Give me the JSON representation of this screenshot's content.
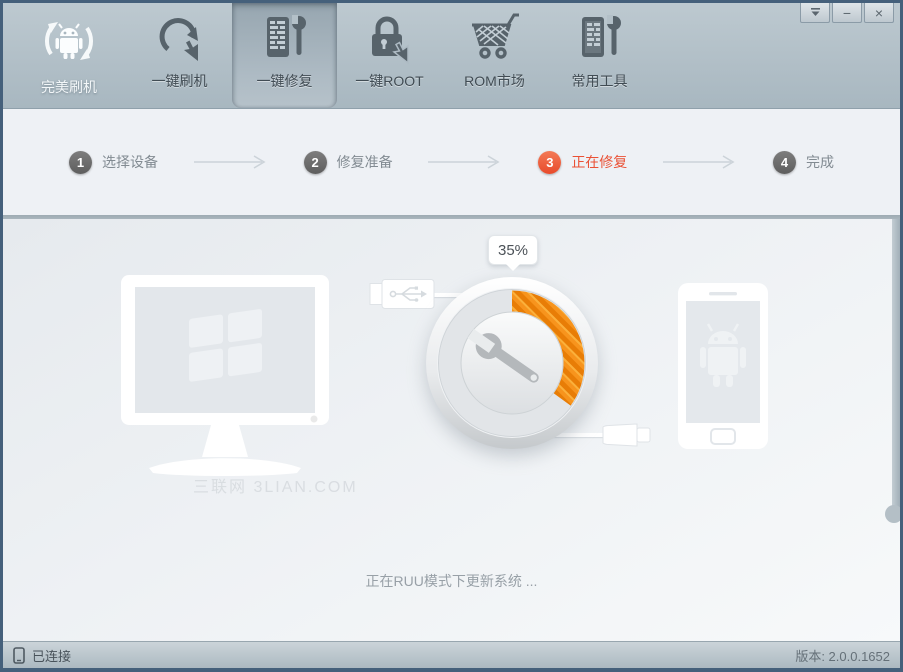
{
  "window": {
    "controls": {
      "minimize": "−",
      "close": "×"
    }
  },
  "toolbar": {
    "logo_label": "完美刷机",
    "items": [
      {
        "id": "flash",
        "label": "一键刷机",
        "selected": false
      },
      {
        "id": "repair",
        "label": "一键修复",
        "selected": true
      },
      {
        "id": "root",
        "label": "一键ROOT",
        "selected": false
      },
      {
        "id": "rom",
        "label": "ROM市场",
        "selected": false
      },
      {
        "id": "tools",
        "label": "常用工具",
        "selected": false
      }
    ]
  },
  "steps": [
    {
      "number": "1",
      "label": "选择设备",
      "active": false
    },
    {
      "number": "2",
      "label": "修复准备",
      "active": false
    },
    {
      "number": "3",
      "label": "正在修复",
      "active": true
    },
    {
      "number": "4",
      "label": "完成",
      "active": false
    }
  ],
  "progress": {
    "percent": 35,
    "label": "35%"
  },
  "main": {
    "watermark": "三联网 3LIAN.COM",
    "status_message": "正在RUU模式下更新系统 ..."
  },
  "statusbar": {
    "connection": "已连接",
    "version": "版本: 2.0.0.1652"
  },
  "icons": {
    "logo": "android-robot-refresh-icon",
    "flash": "refresh-cursor-icon",
    "repair": "phone-wrench-icon",
    "root": "padlock-cursor-icon",
    "rom": "shopping-cart-icon",
    "tools": "phone-wrench-icon",
    "gauge_center": "wrench-icon",
    "connection": "phone-icon"
  },
  "colors": {
    "frame": "#45607b",
    "toolbar_bg": "#aebcc5",
    "accent_orange": "#f7941d",
    "active_step": "#ea5135",
    "icon_gray": "#57636b"
  }
}
